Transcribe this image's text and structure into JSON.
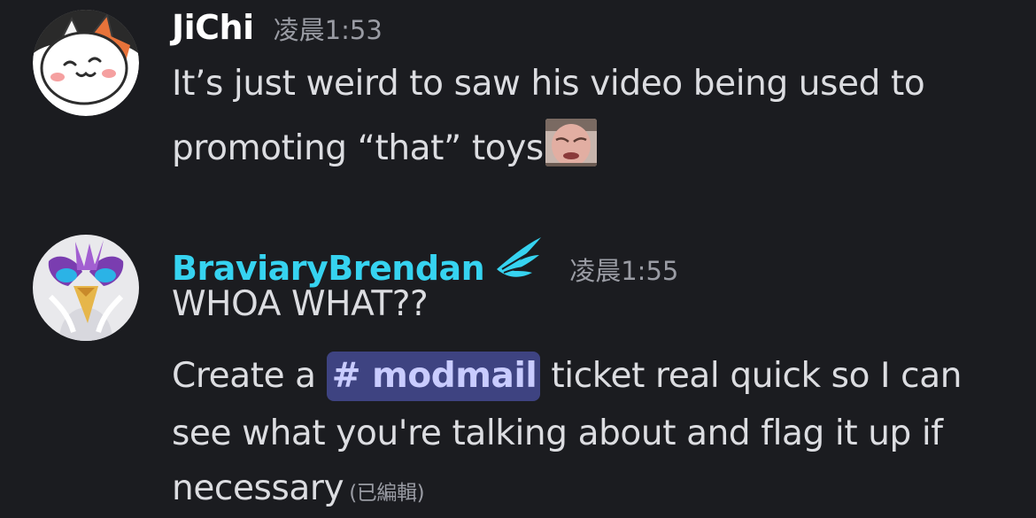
{
  "colors": {
    "background": "#1b1c20",
    "username_default": "#ffffff",
    "username_role": "#36d3f0",
    "text": "#dcdde1",
    "muted": "#9a9ca4",
    "mention_bg": "#3e4381",
    "mention_text": "#c9ccff"
  },
  "messages": [
    {
      "username": "JiChi",
      "timestamp": "凌晨1:53",
      "avatar": "cat-avatar",
      "lines": [
        "It’s just weird to saw his video being used to",
        "promoting “that” toys"
      ],
      "emoji": "crying-face-emoji"
    },
    {
      "username": "BraviaryBrendan",
      "timestamp": "凌晨1:55",
      "avatar": "bird-avatar",
      "badge": "wing-badge-icon",
      "line1": "WHOA WHAT??",
      "line2_before": "Create a",
      "channel_mention": "# modmail",
      "line2_after": "ticket real quick so I can",
      "line3": "see what you're talking about and flag it up if",
      "line4": "necessary",
      "edited": "(已編輯)"
    }
  ]
}
